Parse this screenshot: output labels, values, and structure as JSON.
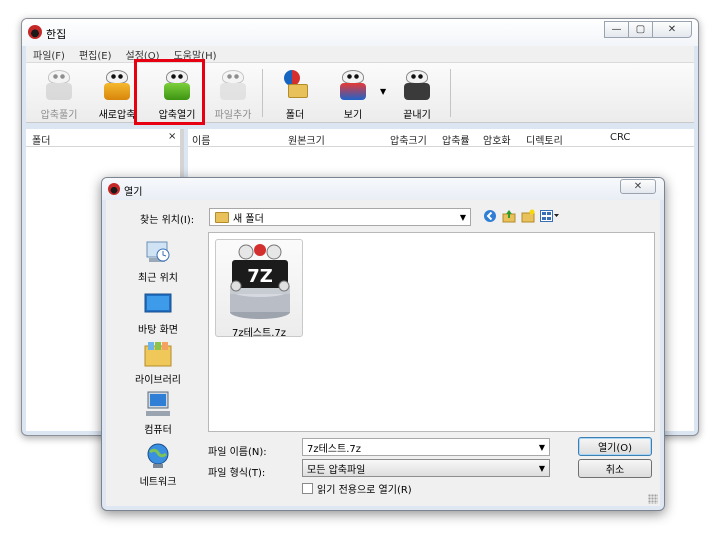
{
  "main_window": {
    "title": "한집",
    "menu": [
      "파일(F)",
      "편집(E)",
      "설정(O)",
      "도움말(H)"
    ],
    "toolbar": [
      {
        "label": "압축풀기",
        "icon": "extract-icon",
        "enabled": false
      },
      {
        "label": "새로압축",
        "icon": "new-archive-icon",
        "enabled": true
      },
      {
        "label": "압축열기",
        "icon": "open-archive-icon",
        "enabled": true
      },
      {
        "label": "파일추가",
        "icon": "add-file-icon",
        "enabled": false
      },
      {
        "label": "폴더",
        "icon": "folder-icon",
        "enabled": true
      },
      {
        "label": "보기",
        "icon": "view-icon",
        "enabled": true
      },
      {
        "label": "끝내기",
        "icon": "exit-icon",
        "enabled": true
      }
    ],
    "folder_pane": {
      "header": "폴더",
      "close": "×"
    },
    "columns": [
      "이름",
      "원본크기",
      "압축크기",
      "압축률",
      "암호화",
      "디렉토리",
      "CRC"
    ]
  },
  "dialog": {
    "title": "열기",
    "look_in_label": "찾는 위치(I):",
    "look_in_value": "새 폴더",
    "places": [
      {
        "label": "최근 위치",
        "icon": "recent-places-icon"
      },
      {
        "label": "바탕 화면",
        "icon": "desktop-icon"
      },
      {
        "label": "라이브러리",
        "icon": "libraries-icon"
      },
      {
        "label": "컴퓨터",
        "icon": "computer-icon"
      },
      {
        "label": "네트워크",
        "icon": "network-icon"
      }
    ],
    "files": [
      {
        "name": "7z테스트.7z",
        "badge": "7Z",
        "icon": "7z-archive-icon"
      }
    ],
    "filename_label": "파일 이름(N):",
    "filename_value": "7z테스트.7z",
    "filetype_label": "파일 형식(T):",
    "filetype_value": "모든 압축파일",
    "readonly_label": "읽기 전용으로 열기(R)",
    "open_button": "열기(O)",
    "cancel_button": "취소"
  }
}
